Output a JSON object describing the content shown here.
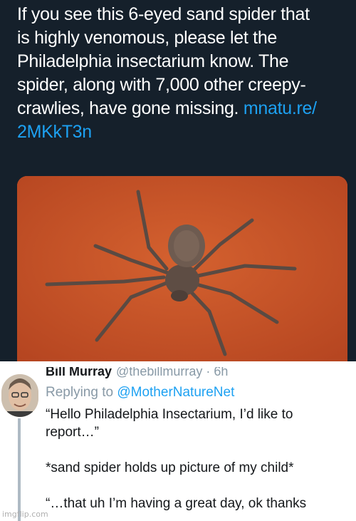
{
  "tweet": {
    "text": "If you see this 6-eyed sand spider that\nis highly venomous, please let the\nPhiladelphia insectarium know. The\nspider, along with 7,000 other creepy-\ncrawlies, have gone missing. ",
    "link_line1": "mnatu.re/",
    "link_line2": "2MKkT3n",
    "image_icon": "spider-photo"
  },
  "reply": {
    "author_name": "Bill Murray",
    "author_handle": "@thebillmurray · 6h",
    "replying_prefix": "Replying to ",
    "replying_to": "@MotherNatureNet",
    "body": "“Hello Philadelphia Insectarium, I’d like to\nreport…”\n\n*sand spider holds up picture of my child*\n\n“…that uh I’m having a great day, ok thanks"
  },
  "watermark": "imgflip.com",
  "colors": {
    "dark_bg": "#15202b",
    "link": "#1da1f2",
    "sand": "#c8532a",
    "muted": "#8899a6"
  }
}
